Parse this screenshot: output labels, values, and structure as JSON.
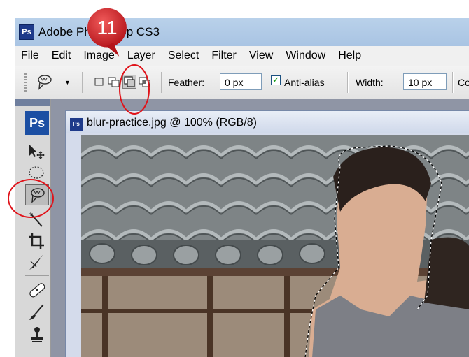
{
  "window": {
    "app_icon": "Ps",
    "title": "Adobe Photoshop CS3"
  },
  "menu": [
    "File",
    "Edit",
    "Image",
    "Layer",
    "Select",
    "Filter",
    "View",
    "Window",
    "Help"
  ],
  "options_bar": {
    "feather_label": "Feather:",
    "feather_value": "0 px",
    "antialias_label": "Anti-alias",
    "antialias_checked": true,
    "width_label": "Width:",
    "width_value": "10 px",
    "cutoff_label": "Co",
    "selected_mode": "subtract-from-selection"
  },
  "toolbox": {
    "logo": "Ps",
    "active_tool": "magnetic-lasso-tool",
    "tools": [
      "move-tool",
      "marquee-tool",
      "magnetic-lasso-tool",
      "magic-wand-tool",
      "crop-tool",
      "slice-tool",
      "healing-brush-tool",
      "brush-tool",
      "clone-stamp-tool"
    ]
  },
  "document": {
    "icon": "Ps",
    "title": "blur-practice.jpg @ 100% (RGB/8)"
  },
  "annotation": {
    "step_number": "11",
    "color": "#e0141b"
  }
}
